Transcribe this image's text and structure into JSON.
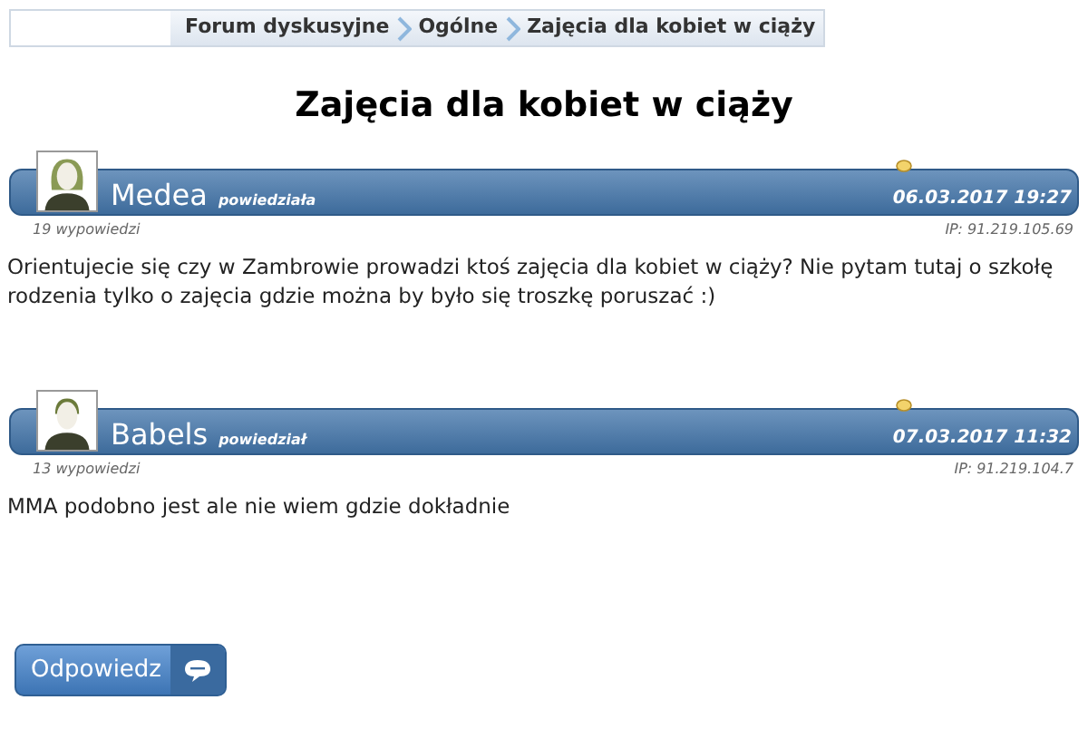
{
  "breadcrumb": [
    "Forum dyskusyjne",
    "Ogólne",
    "Zajęcia dla kobiet w ciąży"
  ],
  "title": "Zajęcia dla kobiet w ciąży",
  "posts": [
    {
      "kind": "female",
      "author": "Medea",
      "verb": "powiedziała",
      "date": "06.03.2017 19:27",
      "post_count": "19 wypowiedzi",
      "ip": "IP: 91.219.105.69",
      "body": "Orientujecie się czy w Zambrowie prowadzi ktoś zajęcia dla kobiet w ciąży? Nie pytam tutaj o szkołę rodzenia tylko o zajęcia gdzie można by było się troszkę poruszać :)"
    },
    {
      "kind": "male",
      "author": "Babels",
      "verb": "powiedział",
      "date": "07.03.2017 11:32",
      "post_count": "13 wypowiedzi",
      "ip": "IP: 91.219.104.7",
      "body": "MMA podobno jest ale nie wiem gdzie dokładnie"
    }
  ],
  "reply_button": "Odpowiedz"
}
